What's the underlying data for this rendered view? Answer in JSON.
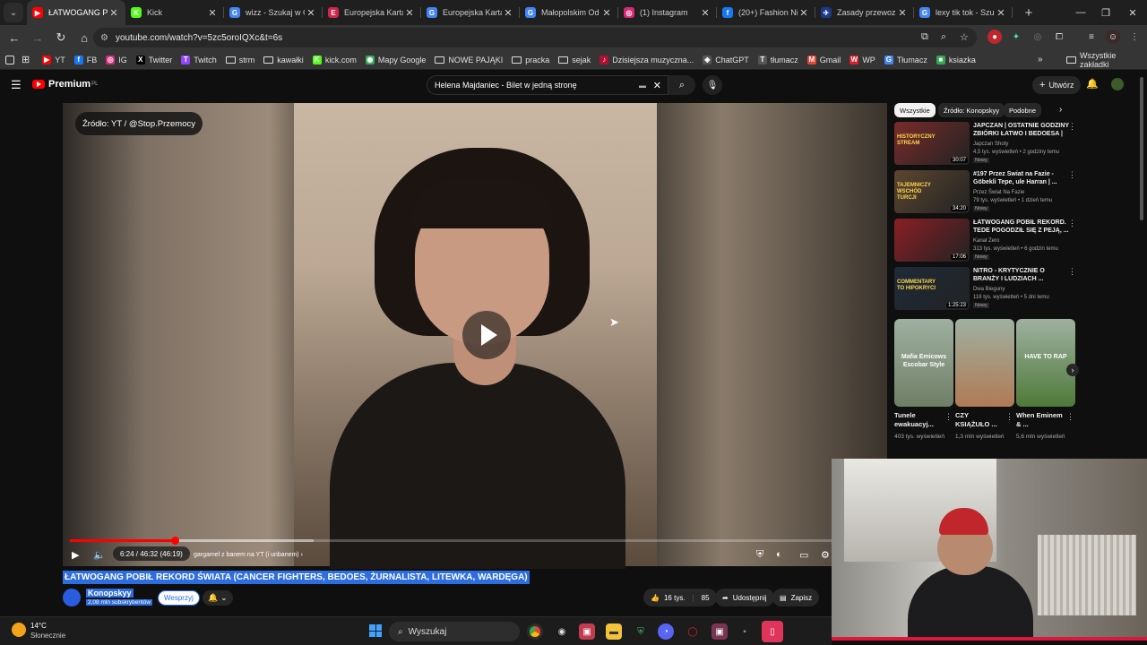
{
  "browser": {
    "tabs": [
      {
        "label": "ŁATWOGANG PO",
        "favicon": "youtube-icon",
        "color": "#ff0000",
        "glyph": "▶",
        "active": true
      },
      {
        "label": "Kick",
        "favicon": "kick-icon",
        "color": "#53fc18",
        "glyph": "K",
        "active": false
      },
      {
        "label": "wizz - Szukaj w G",
        "favicon": "google-icon",
        "color": "#4285f4",
        "glyph": "G",
        "active": false
      },
      {
        "label": "Europejska Karta",
        "favicon": "card-icon",
        "color": "#d0264d",
        "glyph": "E",
        "active": false
      },
      {
        "label": "Europejska Karta",
        "favicon": "google-icon",
        "color": "#4285f4",
        "glyph": "G",
        "active": false
      },
      {
        "label": "Małopolskim Od",
        "favicon": "google-icon",
        "color": "#4285f4",
        "glyph": "G",
        "active": false
      },
      {
        "label": "(1) Instagram",
        "favicon": "instagram-icon",
        "color": "#d62976",
        "glyph": "◎",
        "active": false
      },
      {
        "label": "(20+) Fashion Ni",
        "favicon": "facebook-icon",
        "color": "#1877f2",
        "glyph": "f",
        "active": false
      },
      {
        "label": "Zasady przewozu",
        "favicon": "airline-icon",
        "color": "#1d3a8a",
        "glyph": "✈",
        "active": false
      },
      {
        "label": "lexy tik tok - Szuk",
        "favicon": "google-icon",
        "color": "#4285f4",
        "glyph": "G",
        "active": false
      }
    ],
    "site_label": "",
    "url": "youtube.com/watch?v=5zc5oroIQXc&t=6s",
    "bookmarks": [
      {
        "label": "YT",
        "icon": "youtube-icon",
        "color": "#ff0000",
        "glyph": "▶"
      },
      {
        "label": "FB",
        "icon": "facebook-icon",
        "color": "#1877f2",
        "glyph": "f"
      },
      {
        "label": "IG",
        "icon": "instagram-icon",
        "color": "#d62976",
        "glyph": "◎"
      },
      {
        "label": "Twitter",
        "icon": "x-icon",
        "color": "#000000",
        "glyph": "X"
      },
      {
        "label": "Twitch",
        "icon": "twitch-icon",
        "color": "#9146ff",
        "glyph": "T"
      },
      {
        "label": "strm",
        "icon": "folder-icon",
        "color": "",
        "glyph": ""
      },
      {
        "label": "kawałki",
        "icon": "folder-icon",
        "color": "",
        "glyph": ""
      },
      {
        "label": "kick.com",
        "icon": "kick-icon",
        "color": "#53fc18",
        "glyph": "K"
      },
      {
        "label": "Mapy Google",
        "icon": "maps-icon",
        "color": "#34a853",
        "glyph": "◉"
      },
      {
        "label": "NOWE PAJĄKI",
        "icon": "folder-icon",
        "color": "",
        "glyph": ""
      },
      {
        "label": "pracka",
        "icon": "folder-icon",
        "color": "",
        "glyph": ""
      },
      {
        "label": "sejak",
        "icon": "folder-icon",
        "color": "",
        "glyph": ""
      },
      {
        "label": "Dzisiejsza muzyczna...",
        "icon": "music-icon",
        "color": "#b30f2f",
        "glyph": "♪"
      },
      {
        "label": "ChatGPT",
        "icon": "chatgpt-icon",
        "color": "#555555",
        "glyph": "◈"
      },
      {
        "label": "tłumacz",
        "icon": "translate-icon",
        "color": "#555555",
        "glyph": "T"
      },
      {
        "label": "Gmail",
        "icon": "gmail-icon",
        "color": "#ea4335",
        "glyph": "M"
      },
      {
        "label": "WP",
        "icon": "wp-icon",
        "color": "#e11d2b",
        "glyph": "W"
      },
      {
        "label": "Tłumacz",
        "icon": "translate-icon",
        "color": "#4285f4",
        "glyph": "G"
      },
      {
        "label": "ksiazka",
        "icon": "book-icon",
        "color": "#34a853",
        "glyph": "■"
      }
    ],
    "all_bookmarks": "Wszystkie zakładki"
  },
  "youtube": {
    "brand": "Premium",
    "brand_sup": "PL",
    "search_value": "Helena Majdaniec - Bilet w jedną stronę",
    "create_label": "Utwórz",
    "player": {
      "source_badge": "Źródło: YT / @Stop.Przemocy",
      "time": "6:24 / 46:32 (46:19)",
      "chapter": "gargamel z banem na YT (i unbanem) ›",
      "progress_fraction": 0.138,
      "buffer_fraction": 0.32
    },
    "video_title": "ŁATWOGANG POBIŁ REKORD ŚWIATA (CANCER FIGHTERS, BEDOES, ŻURNALISTA, LITEWKA, WARDĘGA)",
    "channel": {
      "name": "Konopskyy",
      "subscribers": "2,08 mln subskrybentów",
      "support_label": "Wesprzyj"
    },
    "actions": {
      "likes": "16 tys.",
      "comments": "85",
      "share": "Udostępnij",
      "save": "Zapisz"
    },
    "chips": [
      "Wszystkie",
      "Źródło: Konopskyy",
      "Podobne"
    ],
    "recommendations": [
      {
        "title": "JAPCZAN | OSTATNIE GODZINY ZBIÓRKI ŁATWO I BEDOESA |",
        "channel": "Japczan Shoty",
        "meta": "4,5 tys. wyświetleń • 2 godziny temu",
        "badge": "Nowy",
        "duration": "30:07",
        "thumb_overlay": "HISTORYCZNY STREAM",
        "color": "#7a2b2b"
      },
      {
        "title": "#197 Przez Świat na Fazie - Göbekli Tepe, ule Harran | ...",
        "channel": "Przez Świat Na Fazie",
        "meta": "79 tys. wyświetleń • 1 dzień temu",
        "badge": "Nowy",
        "duration": "34:20",
        "thumb_overlay": "TAJEMNICZY WSCHÓD TURCJI",
        "color": "#5c4630"
      },
      {
        "title": "ŁATWOGANG POBIŁ REKORD. TEDE POGODZIŁ SIĘ Z PEJĄ, ...",
        "channel": "Kanał Zero",
        "meta": "313 tys. wyświetleń • 6 godzin temu",
        "badge": "Nowy",
        "duration": "17:06",
        "thumb_overlay": "",
        "color": "#8a1f25"
      },
      {
        "title": "NITRO - KRYTYCZNIE O BRANŻY I LUDZIACH ...",
        "channel": "Dwa Bieguny",
        "meta": "116 tys. wyświetleń • 5 dni temu",
        "badge": "Nowy",
        "duration": "1:25:23",
        "thumb_overlay": "COMMENTARY TO HIPOKRYCI",
        "color": "#1f2a3a"
      }
    ],
    "shorts": [
      {
        "title": "Tunele ewakuacyj...",
        "views": "403 tys. wyświetleń",
        "overlay": "Mafia Emicows Escobar Style",
        "color": "#6f7f66"
      },
      {
        "title": "CZY KSIĄŻUŁO ...",
        "views": "1,3 mln wyświetleń",
        "overlay": "",
        "color": "#b07a55"
      },
      {
        "title": "When Eminem & ...",
        "views": "5,6 mln wyświetleń",
        "overlay": "HAVE TO RAP",
        "color": "#4f7a3a"
      }
    ]
  },
  "taskbar": {
    "temperature": "14°C",
    "weather": "Słonecznie",
    "search_placeholder": "Wyszukaj"
  }
}
